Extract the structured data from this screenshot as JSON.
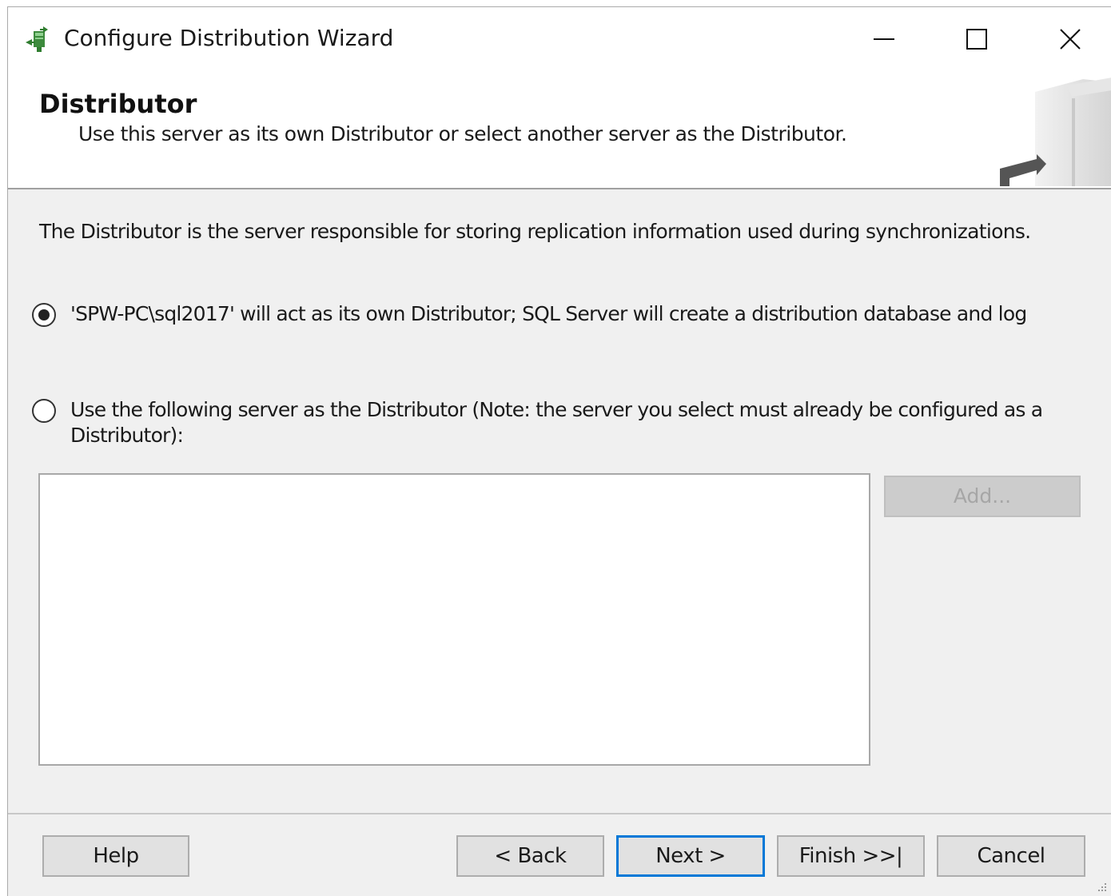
{
  "window": {
    "title": "Configure Distribution Wizard"
  },
  "header": {
    "title": "Distributor",
    "subtitle": "Use this server as its own Distributor or select another server as the Distributor."
  },
  "content": {
    "intro": "The Distributor is the server responsible for storing replication information used during synchronizations.",
    "option_own": {
      "label": "'SPW-PC\\sql2017' will act as its own Distributor; SQL Server will create a distribution database and log",
      "checked": true
    },
    "option_other": {
      "label": "Use the following server as the Distributor (Note: the server you select must already be configured as a Distributor):",
      "checked": false
    },
    "add_button": "Add..."
  },
  "footer": {
    "help": "Help",
    "back": "< Back",
    "next": "Next >",
    "finish": "Finish >>|",
    "cancel": "Cancel"
  },
  "colors": {
    "accent": "#0078d7",
    "dialog_bg": "#f0f0f0",
    "disabled_button_bg": "#cccccc"
  }
}
